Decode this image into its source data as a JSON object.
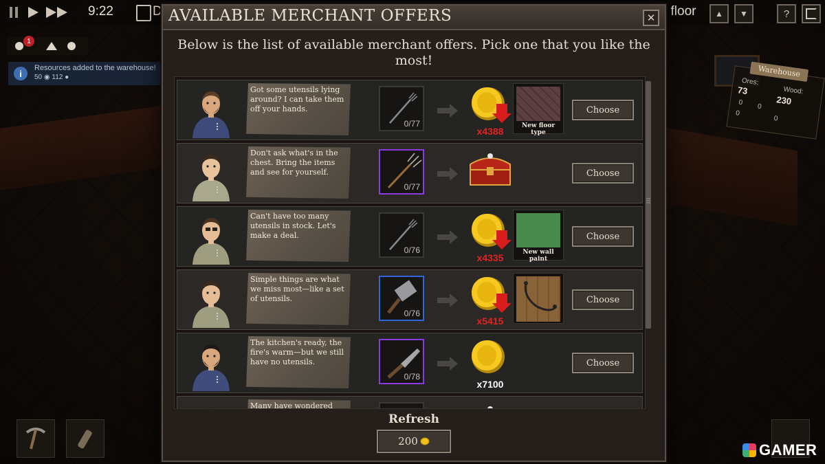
{
  "hud": {
    "time": "9:22",
    "day_label": "D",
    "floor_label": "l floor",
    "help_label": "?",
    "notification_count": "1"
  },
  "notice": {
    "text": "Resources added to the warehouse!",
    "amounts": "50 ◉ 112 ●"
  },
  "warehouse": {
    "title": "Warehouse",
    "ores_label": "Ores:",
    "ores_value": "73",
    "wood_label": "Wood:",
    "wood_value": "230",
    "zero_a": "0",
    "zero_b": "0",
    "zero_c": "0",
    "zero_d": "0"
  },
  "dialog": {
    "title": "AVAILABLE MERCHANT OFFERS",
    "close_label": "✕",
    "subtitle": "Below is the list of available merchant offers. Pick one that you like the most!",
    "refresh_label": "Refresh",
    "refresh_cost": "200"
  },
  "offers": [
    {
      "text": "Got some utensils lying around? I can take them off your hands.",
      "item": "fork-icon",
      "item_count": "0/77",
      "item_rarity": "common",
      "reward_amount": "x4388",
      "reward_color": "#e02424",
      "reward_type": "coin-down",
      "unlock_label": "New floor type",
      "unlock_color": "#5a4040",
      "choose_label": "Choose"
    },
    {
      "text": "Don't ask what's in the chest. Bring the items and see for yourself.",
      "item": "pitchfork-icon",
      "item_count": "0/77",
      "item_rarity": "epic",
      "reward_amount": "",
      "reward_color": "#ffffff",
      "reward_type": "chest",
      "unlock_label": "",
      "choose_label": "Choose"
    },
    {
      "text": "Can't have too many utensils in stock. Let's make a deal.",
      "item": "fork-icon",
      "item_count": "0/76",
      "item_rarity": "common",
      "reward_amount": "x4335",
      "reward_color": "#e02424",
      "reward_type": "coin-down",
      "unlock_label": "New wall paint",
      "unlock_color": "#4a8a4f",
      "choose_label": "Choose"
    },
    {
      "text": "Simple things are what we miss most—like a set of utensils.",
      "item": "cleaver-icon",
      "item_count": "0/76",
      "item_rarity": "rare",
      "reward_amount": "x5415",
      "reward_color": "#e02424",
      "reward_type": "coin-down",
      "unlock_label": "",
      "unlock_color": "#8a6238",
      "choose_label": "Choose"
    },
    {
      "text": "The kitchen's ready, the fire's warm—but we still have no utensils.",
      "item": "knife-icon",
      "item_count": "0/78",
      "item_rarity": "epic",
      "reward_amount": "x7100",
      "reward_color": "#ffffff",
      "reward_type": "coin",
      "unlock_label": "",
      "choose_label": "Choose"
    },
    {
      "text": "Many have wondered",
      "item": "",
      "item_count": "",
      "item_rarity": "common",
      "reward_amount": "",
      "reward_color": "#ffffff",
      "reward_type": "chest",
      "unlock_label": "",
      "choose_label": ""
    }
  ],
  "watermark": "GAMER"
}
